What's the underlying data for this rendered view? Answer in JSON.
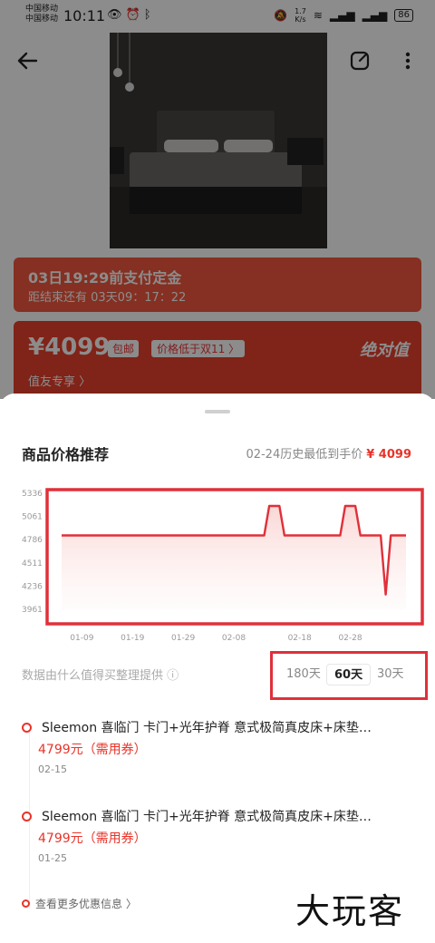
{
  "status": {
    "carrier1": "中国移动",
    "carrier2": "中国移动",
    "time": "10:11",
    "speed": "1.7",
    "speed_unit": "K/s",
    "battery": "86"
  },
  "deposit": {
    "title": "03日19:29前支付定金",
    "countdown": "距结束还有 03天09：17：22"
  },
  "price_card": {
    "price": "¥4099",
    "free_shipping": "包邮",
    "lower_tag": "价格低于双11 〉",
    "badge": "绝对值",
    "member": "值友专享 〉"
  },
  "sheet": {
    "title": "商品价格推荐",
    "hist_low_label": "02-24历史最低到手价",
    "hist_low_price": "¥ 4099",
    "source_note": "数据由什么值得买整理提供",
    "ranges": [
      "180天",
      "60天",
      "30天"
    ],
    "active_range": "60天",
    "deals": [
      {
        "title": "Sleemon 喜临门 卡门+光年护脊 意式极简真皮床+床垫…",
        "price": "4799元（需用券）",
        "date": "02-15"
      },
      {
        "title": "Sleemon 喜临门 卡门+光年护脊 意式极简真皮床+床垫…",
        "price": "4799元（需用券）",
        "date": "01-25"
      }
    ],
    "more": "查看更多优惠信息 〉",
    "watermark": "大玩客"
  },
  "colors": {
    "accent": "#e8342a",
    "highlight_box": "#e0303a"
  },
  "chart_data": {
    "type": "line",
    "x_tick_labels": [
      "01-09",
      "01-19",
      "01-29",
      "02-08",
      "02-18",
      "02-28"
    ],
    "y_tick_labels": [
      "5336",
      "5061",
      "4786",
      "4511",
      "4236",
      "3961"
    ],
    "y_ticks": [
      5336,
      5061,
      4786,
      4511,
      4236,
      3961
    ],
    "ylim": [
      3961,
      5336
    ],
    "x": [
      0,
      8,
      16,
      24,
      32,
      40,
      41,
      43,
      44,
      52,
      55,
      56,
      58,
      59,
      62,
      63,
      64,
      65,
      67,
      68
    ],
    "values": [
      4836,
      4836,
      4836,
      4836,
      4836,
      4836,
      5186,
      5186,
      4836,
      4836,
      4836,
      5186,
      5186,
      4836,
      4836,
      4836,
      4136,
      4836,
      4836,
      4836
    ],
    "x_tick_positions": [
      4,
      14,
      24,
      34,
      47,
      57
    ],
    "xlim": [
      0,
      68
    ]
  }
}
